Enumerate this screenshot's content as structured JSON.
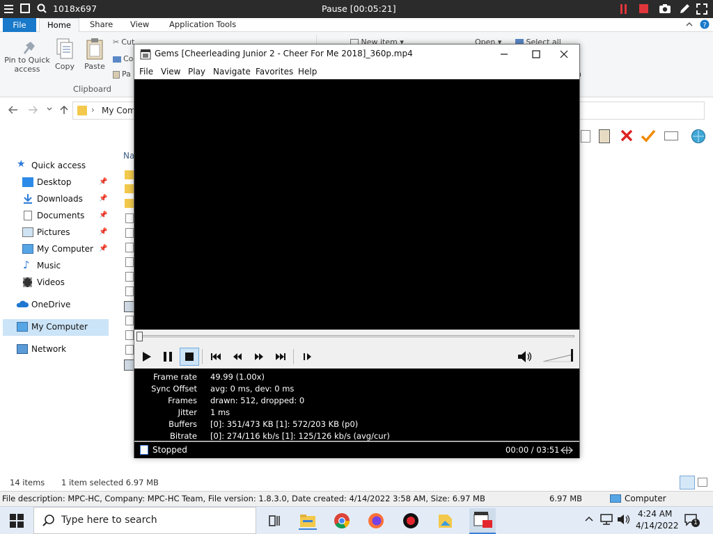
{
  "recorder": {
    "resolution": "1018x697",
    "status": "Pause [00:05:21]"
  },
  "explorer": {
    "tabs": {
      "file": "File",
      "home": "Home",
      "share": "Share",
      "view": "View",
      "app_tools": "Application Tools"
    },
    "ribbon": {
      "pin_line1": "Pin to Quick",
      "pin_line2": "access",
      "copy": "Copy",
      "paste": "Paste",
      "cut": "Cut",
      "co": "Co",
      "pa": "Pa",
      "clipboard_group": "Clipboard",
      "new_item": "New item",
      "open": "Open",
      "select_all": "Select all",
      "n": "n"
    },
    "address": {
      "path": "My Com"
    },
    "column_name": "Na",
    "nav": [
      {
        "label": "Quick access"
      },
      {
        "label": "Desktop"
      },
      {
        "label": "Downloads"
      },
      {
        "label": "Documents"
      },
      {
        "label": "Pictures"
      },
      {
        "label": "My Computer"
      },
      {
        "label": "Music"
      },
      {
        "label": "Videos"
      },
      {
        "label": "OneDrive"
      },
      {
        "label": "My Computer"
      },
      {
        "label": "Network"
      }
    ],
    "status": {
      "items": "14 items",
      "selected": "1 item selected  6.97 MB"
    },
    "info": {
      "description": "File description: MPC-HC, Company: MPC-HC Team, File version: 1.8.3.0, Date created: 4/14/2022 3:58 AM, Size: 6.97 MB",
      "size": "6.97 MB",
      "location": "Computer"
    }
  },
  "player": {
    "title": "Gems  [Cheerleading Junior 2 - Cheer For Me 2018]_360p.mp4",
    "menu": [
      "File",
      "View",
      "Play",
      "Navigate",
      "Favorites",
      "Help"
    ],
    "stats": [
      {
        "k": "Frame rate",
        "v": "49.99 (1.00x)"
      },
      {
        "k": "Sync Offset",
        "v": "avg: 0 ms, dev: 0 ms"
      },
      {
        "k": "Frames",
        "v": "drawn: 512, dropped: 0"
      },
      {
        "k": "Jitter",
        "v": "1 ms"
      },
      {
        "k": "Buffers",
        "v": "[0]: 351/473 KB [1]: 572/203 KB (p0)"
      },
      {
        "k": "Bitrate",
        "v": "[0]: 274/116 kb/s [1]: 125/126 kb/s (avg/cur)"
      }
    ],
    "status": "Stopped",
    "time": "00:00 / 03:51",
    "seek_fraction": 0.0
  },
  "taskbar": {
    "search_placeholder": "Type here to search",
    "time": "4:24 AM",
    "date": "4/14/2022",
    "notifications": "1"
  }
}
